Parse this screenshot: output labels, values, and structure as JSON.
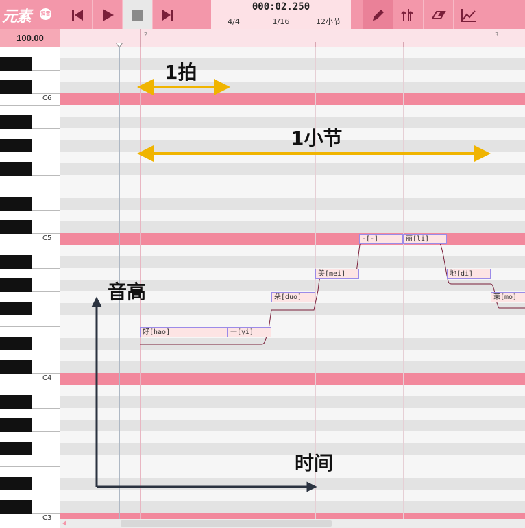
{
  "app": {
    "logo_text": "元素",
    "logo_badge": "调音"
  },
  "toolbar": {
    "icons": [
      "skip-back-icon",
      "play-icon",
      "stop-icon",
      "skip-forward-icon",
      "pencil-icon",
      "split-icon",
      "eraser-icon",
      "curve-icon"
    ]
  },
  "transport": {
    "time": "000:02.250",
    "time_signature": "4/4",
    "quantize": "1/16",
    "bars": "12小节"
  },
  "zoom": "100.00",
  "ruler": {
    "bar_labels": [
      "2",
      "3"
    ]
  },
  "piano": {
    "octave_labels": [
      "C6",
      "C5",
      "C4",
      "C3"
    ]
  },
  "notes": [
    {
      "lyric": "好[hao]"
    },
    {
      "lyric": "一[yi]"
    },
    {
      "lyric": "朵[duo]"
    },
    {
      "lyric": "美[mei]"
    },
    {
      "lyric": "-[-]"
    },
    {
      "lyric": "丽[li]"
    },
    {
      "lyric": "地[di]"
    },
    {
      "lyric": "茉[mo]"
    }
  ],
  "annotations": {
    "beat": "1拍",
    "bar": "1小节",
    "pitch": "音高",
    "time": "时间"
  },
  "colors": {
    "accent": "#f397aa",
    "octave_row": "#f2889c",
    "note_fill": "#fde4e4",
    "note_border": "#9b8be8",
    "annotation_arrow": "#f0b400",
    "axis_arrow": "#2b3340"
  }
}
